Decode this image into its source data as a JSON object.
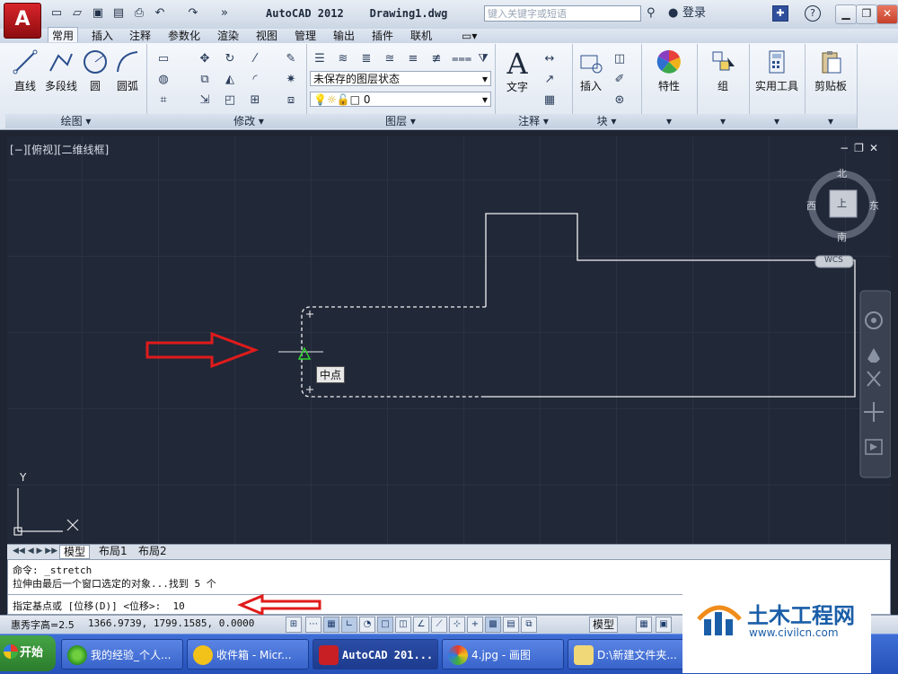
{
  "titlebar": {
    "app_button": "A",
    "title": "AutoCAD 2012    Drawing1.dwg",
    "search_placeholder": "键入关键字或短语",
    "login": "登录",
    "help": "?"
  },
  "tabs": [
    "常用",
    "插入",
    "注释",
    "参数化",
    "渲染",
    "视图",
    "管理",
    "输出",
    "插件",
    "联机"
  ],
  "active_tab": "常用",
  "ribbon": {
    "draw_tools": [
      "直线",
      "多段线",
      "圆",
      "圆弧"
    ],
    "draw_panel": "绘图",
    "modify_panel": "修改",
    "layer_state": "未保存的图层状态",
    "layer_value": "0",
    "layer_panel": "图层",
    "text_label": "文字",
    "annotation_panel": "注释",
    "insert_label": "插入",
    "block_panel": "块",
    "properties_label": "特性",
    "group_label": "组",
    "utilities_label": "实用工具",
    "clipboard_label": "剪贴板"
  },
  "viewport": {
    "label": "[−][俯视][二维线框]",
    "compass": {
      "north": "北",
      "south": "南",
      "east": "东",
      "west": "西",
      "top": "上"
    },
    "wcs": "WCS",
    "tooltip": "中点",
    "axis_y": "Y",
    "axis_x": "X"
  },
  "layout_tabs": [
    "模型",
    "布局1",
    "布局2"
  ],
  "command": {
    "line1": "命令: _stretch",
    "line2": "拉伸由最后一个窗口选定的对象...找到 5 个",
    "prompt": "指定基点或 [位移(D)] <位移>:  10"
  },
  "status": {
    "text_height": "惠秀字高=2.5",
    "coords": "1366.9739, 1799.1585, 0.0000",
    "model": "模型"
  },
  "taskbar": {
    "start": "开始",
    "items": [
      "我的经验_个人...",
      "收件箱 - Micr...",
      "AutoCAD 201...",
      "4.jpg - 画图",
      "D:\\新建文件夹..."
    ]
  },
  "watermark": {
    "name": "土木工程网",
    "url": "www.civilcn.com"
  },
  "colors": {
    "viewport_bg": "#212838",
    "accent_red": "#d8242a",
    "taskbar_blue": "#2450b8",
    "watermark_blue": "#1a5ea8"
  }
}
